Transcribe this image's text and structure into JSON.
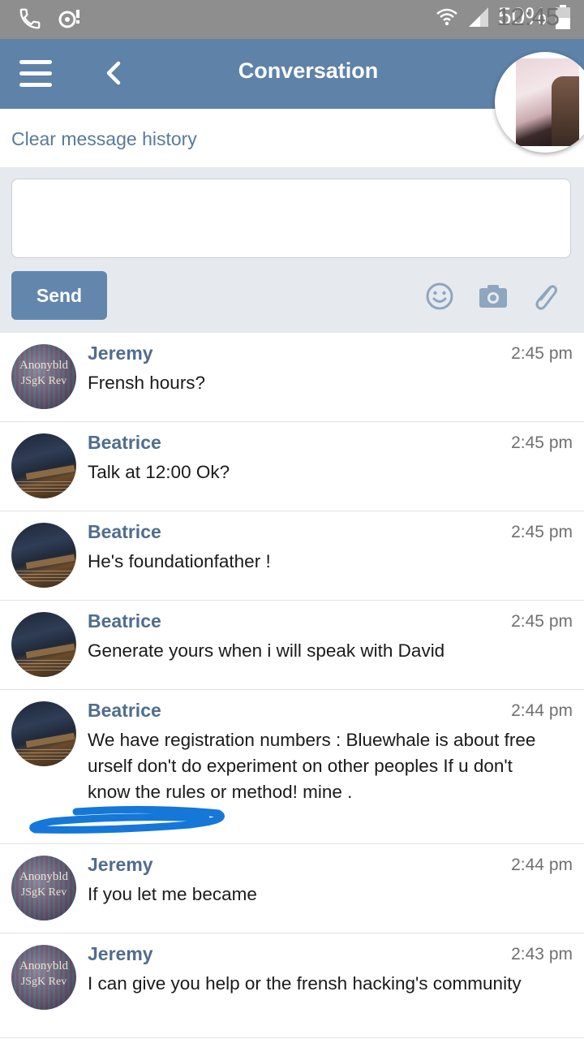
{
  "status_bar": {
    "battery_percent": "50%",
    "time": "12:45",
    "icons": [
      "phone-icon",
      "voicemail-icon",
      "wifi-icon",
      "signal-icon",
      "battery-icon"
    ]
  },
  "header": {
    "title": "Conversation",
    "menu_icon": "hamburger-icon",
    "back_icon": "chevron-left-icon",
    "accent_color": "#5e82a8"
  },
  "clear_history": "Clear message history",
  "compose": {
    "placeholder": "",
    "value": "",
    "send_label": "Send",
    "tools": [
      "smiley-icon",
      "camera-icon",
      "paperclip-icon"
    ]
  },
  "messages": [
    {
      "sender": "Jeremy",
      "time": "2:45 pm",
      "text": "Frensh hours?",
      "avatar": "jeremy",
      "avatar_text_1": "Anonybld",
      "avatar_text_2": "JSgK Rev"
    },
    {
      "sender": "Beatrice",
      "time": "2:45 pm",
      "text": "Talk at 12:00 Ok?",
      "avatar": "beatrice"
    },
    {
      "sender": "Beatrice",
      "time": "2:45 pm",
      "text": "He's foundationfather !",
      "avatar": "beatrice"
    },
    {
      "sender": "Beatrice",
      "time": "2:45 pm",
      "text": "Generate yours when i will speak with David",
      "avatar": "beatrice"
    },
    {
      "sender": "Beatrice",
      "time": "2:44 pm",
      "text": "We have registration numbers : Bluewhale is about free urself don't do experiment on other peoples If u don't know the rules or method! mine .",
      "avatar": "beatrice",
      "redacted": true
    },
    {
      "sender": "Jeremy",
      "time": "2:44 pm",
      "text": "If you let me became",
      "avatar": "jeremy",
      "avatar_text_1": "Anonybld",
      "avatar_text_2": "JSgK Rev"
    },
    {
      "sender": "Jeremy",
      "time": "2:43 pm",
      "text": "I can give you help or the frensh hacking's community",
      "avatar": "jeremy",
      "avatar_text_1": "Anonybld",
      "avatar_text_2": "JSgK Rev"
    }
  ]
}
